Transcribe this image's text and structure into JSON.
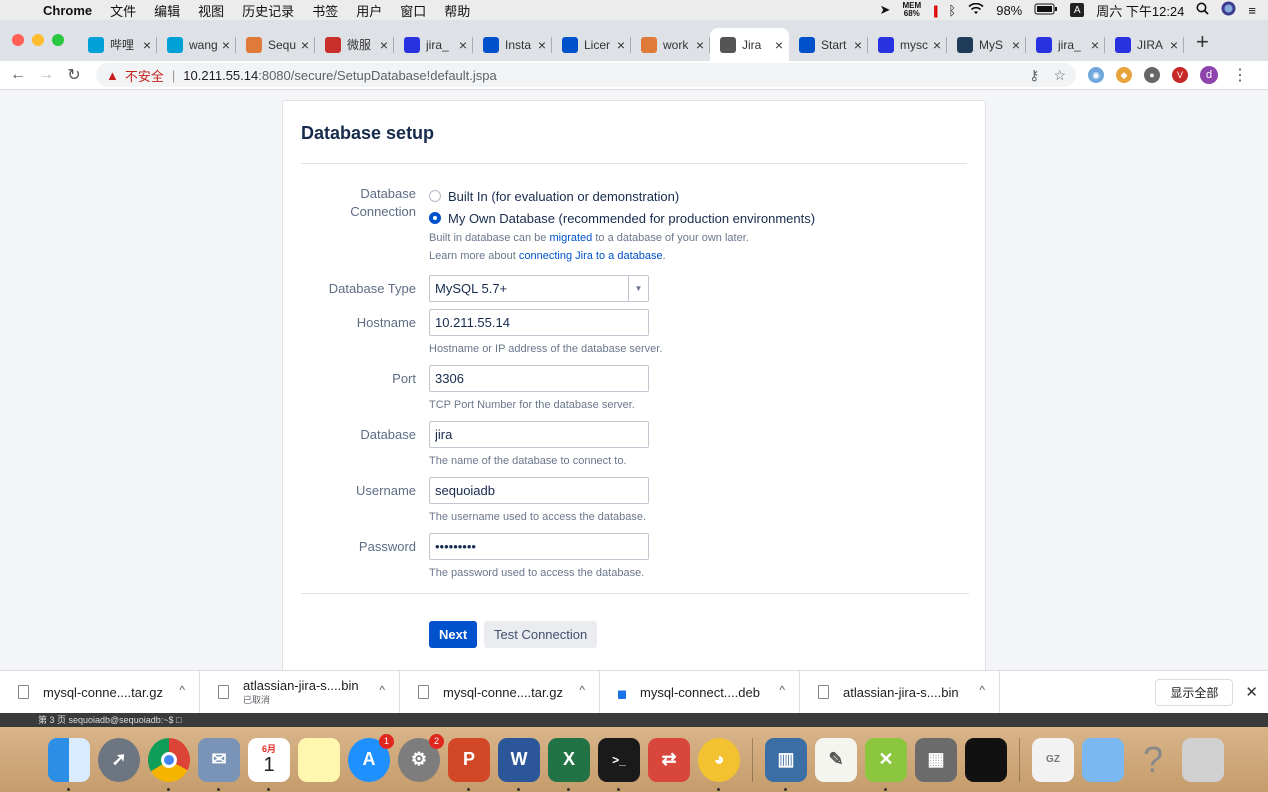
{
  "menubar": {
    "app": "Chrome",
    "items": [
      "文件",
      "编辑",
      "视图",
      "历史记录",
      "书签",
      "用户",
      "窗口",
      "帮助"
    ],
    "mem_label": "MEM",
    "mem_value": "68%",
    "battery": "98%",
    "ime": "A",
    "clock": "周六 下午12:24"
  },
  "tabs": [
    {
      "label": "哔哩",
      "icon": "bilibili-icon",
      "color": "#00a1d6"
    },
    {
      "label": "wang",
      "icon": "bilibili-icon",
      "color": "#00a1d6"
    },
    {
      "label": "Sequ",
      "icon": "sequoia-icon",
      "color": "#e07a3a"
    },
    {
      "label": "微服",
      "icon": "csdn-icon",
      "color": "#c9302c"
    },
    {
      "label": "jira_",
      "icon": "baidu-paw-icon",
      "color": "#2932e1"
    },
    {
      "label": "Insta",
      "icon": "atlassian-icon",
      "color": "#0052cc"
    },
    {
      "label": "Licer",
      "icon": "atlassian-icon",
      "color": "#0052cc"
    },
    {
      "label": "work",
      "icon": "sequoia-icon",
      "color": "#e07a3a"
    },
    {
      "label": "Jira",
      "icon": "globe-icon",
      "color": "#555555"
    },
    {
      "label": "Start",
      "icon": "atlassian-icon",
      "color": "#0052cc"
    },
    {
      "label": "mysc",
      "icon": "baidu-paw-icon",
      "color": "#2932e1"
    },
    {
      "label": "MyS",
      "icon": "mysql-icon",
      "color": "#1f3b57"
    },
    {
      "label": "jira_",
      "icon": "baidu-paw-icon",
      "color": "#2932e1"
    },
    {
      "label": "JIRA",
      "icon": "baidu-paw-icon",
      "color": "#2932e1"
    }
  ],
  "active_tab_index": 8,
  "address": {
    "warning": "不安全",
    "host": "10.211.55.14",
    "path": ":8080/secure/SetupDatabase!default.jspa"
  },
  "setup": {
    "title": "Database setup",
    "connection_label_1": "Database",
    "connection_label_2": "Connection",
    "option_builtin": "Built In (for evaluation or demonstration)",
    "option_own": "My Own Database (recommended for production environments)",
    "help_migrate_pre": "Built in database can be ",
    "help_migrate_link": "migrated",
    "help_migrate_post": " to a database of your own later.",
    "help_learn_pre": "Learn more about ",
    "help_learn_link": "connecting Jira to a database",
    "help_learn_post": ".",
    "type_label": "Database Type",
    "type_value": "MySQL 5.7+",
    "hostname_label": "Hostname",
    "hostname_value": "10.211.55.14",
    "hostname_help": "Hostname or IP address of the database server.",
    "port_label": "Port",
    "port_value": "3306",
    "port_help": "TCP Port Number for the database server.",
    "database_label": "Database",
    "database_value": "jira",
    "database_help": "The name of the database to connect to.",
    "username_label": "Username",
    "username_value": "sequoiadb",
    "username_help": "The username used to access the database.",
    "password_label": "Password",
    "password_value": "•••••••••",
    "password_help": "The password used to access the database.",
    "next_label": "Next",
    "test_label": "Test Connection"
  },
  "downloads": {
    "items": [
      {
        "name": "mysql-conne....tar.gz",
        "status": ""
      },
      {
        "name": "atlassian-jira-s....bin",
        "status": "已取消"
      },
      {
        "name": "mysql-conne....tar.gz",
        "status": ""
      },
      {
        "name": "mysql-connect....deb",
        "status": ""
      },
      {
        "name": "atlassian-jira-s....bin",
        "status": ""
      }
    ],
    "show_all": "显示全部"
  },
  "terminal": {
    "text": "第 3 页  sequoiadb@sequoiadb:~$ □"
  },
  "dock": {
    "calendar_month": "6月",
    "calendar_day": "1",
    "appstore_badge": "1",
    "prefs_badge": "2",
    "help_glyph": "?"
  }
}
